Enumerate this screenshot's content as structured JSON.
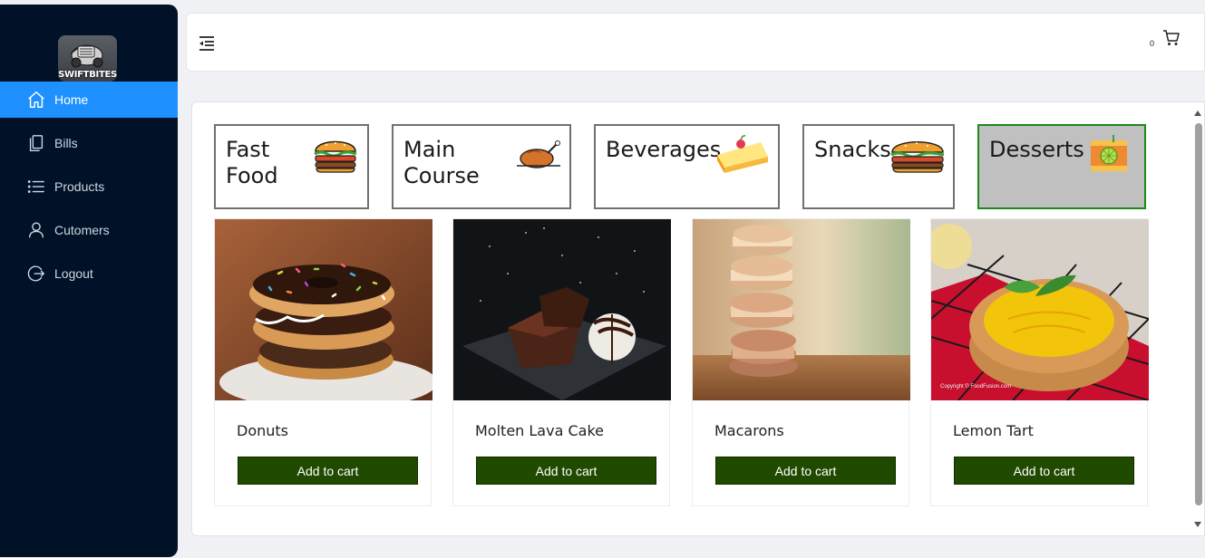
{
  "brand": {
    "name": "SWIFTBITES"
  },
  "sidebar": {
    "items": [
      {
        "label": "Home",
        "icon": "home-icon",
        "active": true
      },
      {
        "label": "Bills",
        "icon": "bills-icon",
        "active": false
      },
      {
        "label": "Products",
        "icon": "list-icon",
        "active": false
      },
      {
        "label": "Cutomers",
        "icon": "user-icon",
        "active": false
      },
      {
        "label": "Logout",
        "icon": "logout-icon",
        "active": false
      }
    ]
  },
  "header": {
    "cart_count": "0",
    "cart_icon": "cart-icon",
    "menu_icon": "menu-collapse-icon"
  },
  "categories": [
    {
      "label": "Fast Food",
      "icon": "burger-icon",
      "selected": false
    },
    {
      "label": "Main Course",
      "icon": "roast-chicken-icon",
      "selected": false
    },
    {
      "label": "Beverages",
      "icon": "cake-slice-icon",
      "selected": false
    },
    {
      "label": "Snacks",
      "icon": "burger-icon",
      "selected": false
    },
    {
      "label": "Desserts",
      "icon": "juice-icon",
      "selected": true
    }
  ],
  "products": [
    {
      "name": "Donuts",
      "button": "Add to cart"
    },
    {
      "name": "Molten Lava Cake",
      "button": "Add to cart"
    },
    {
      "name": "Macarons",
      "button": "Add to cart"
    },
    {
      "name": "Lemon Tart",
      "button": "Add to cart"
    }
  ],
  "colors": {
    "sidebar_bg": "#011128",
    "active_nav": "#1e90ff",
    "add_button": "#1f4a00",
    "selected_category_border": "#1a8a1a"
  }
}
